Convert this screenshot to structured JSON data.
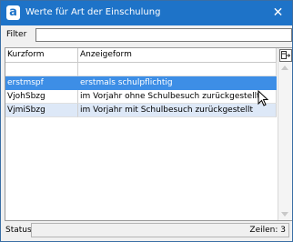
{
  "window": {
    "app_icon_letter": "a",
    "title": "Werte für Art der Einschulung",
    "close_glyph": "✕"
  },
  "filter": {
    "label": "Filter",
    "value": ""
  },
  "table": {
    "columns": [
      "Kurzform",
      "Anzeigeform"
    ],
    "rows": [
      {
        "kurzform": "",
        "anzeigeform": ""
      },
      {
        "kurzform": "erstmspf",
        "anzeigeform": "erstmals schulpflichtig"
      },
      {
        "kurzform": "VjohSbzg",
        "anzeigeform": "im Vorjahr ohne Schulbesuch zurückgestellt"
      },
      {
        "kurzform": "VjmiSbzg",
        "anzeigeform": "im Vorjahr mit Schulbesuch zurückgestellt"
      }
    ],
    "selected_row": 1
  },
  "status": {
    "label": "Status",
    "rows_count": "Zeilen: 3"
  },
  "colors": {
    "titlebar": "#1e73c8",
    "selection": "#3d8ee6",
    "alt_row": "#dde8f7"
  },
  "icons": {
    "app": "app-logo-icon",
    "close": "close-icon",
    "column_chooser": "column-chooser-icon",
    "scroll_up": "scroll-up-arrow-icon",
    "scroll_down": "scroll-down-arrow-icon",
    "cursor": "mouse-cursor-icon"
  }
}
